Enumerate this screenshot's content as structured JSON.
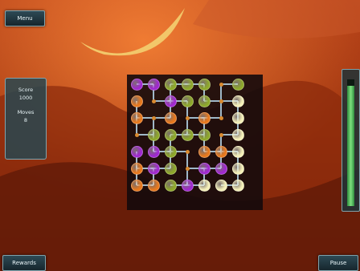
{
  "buttons": {
    "menu": "Menu",
    "rewards": "Rewards",
    "pause": "Pause"
  },
  "stats": {
    "score_label": "Score",
    "score_value": "1000",
    "moves_label": "Moves",
    "moves_value": "8"
  },
  "meter": {
    "level": 0.95,
    "color": "#5fd06a"
  },
  "colors": {
    "purple": "#a028d0",
    "orange": "#e8781c",
    "olive": "#8ea82a",
    "cream": "#f4efb8",
    "pipe": "#9fb8c8"
  },
  "board": {
    "rows": [
      [
        "purple",
        "purple",
        "olive",
        "olive",
        "olive",
        "empty",
        "olive"
      ],
      [
        "orange",
        "empty",
        "purple",
        "olive",
        "olive",
        "empty",
        "cream"
      ],
      [
        "orange",
        "empty",
        "orange",
        "empty",
        "orange",
        "empty",
        "cream"
      ],
      [
        "empty",
        "olive",
        "olive",
        "olive",
        "olive",
        "empty",
        "cream"
      ],
      [
        "purple",
        "purple",
        "olive",
        "empty",
        "orange",
        "orange",
        "cream"
      ],
      [
        "orange",
        "purple",
        "olive",
        "empty",
        "purple",
        "purple",
        "cream"
      ],
      [
        "orange",
        "orange",
        "olive",
        "purple",
        "cream",
        "cream",
        "cream"
      ]
    ]
  }
}
